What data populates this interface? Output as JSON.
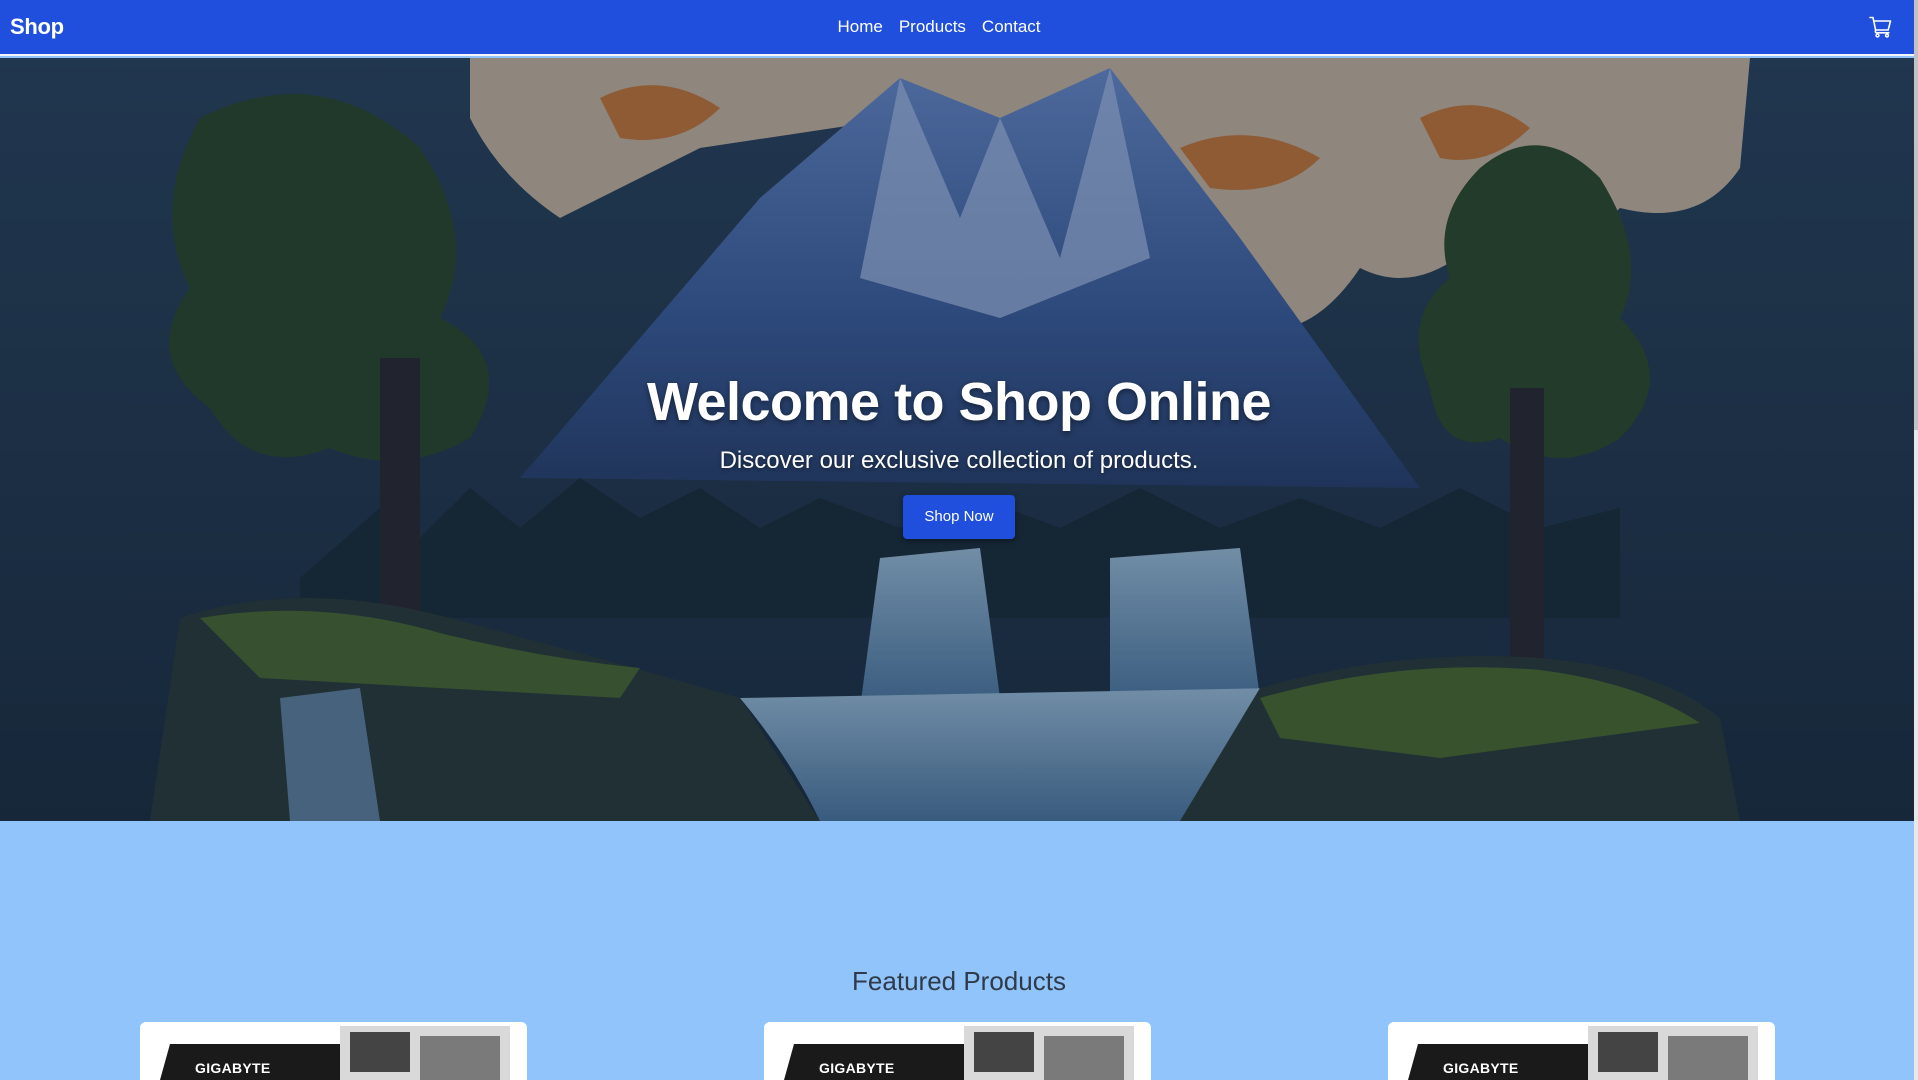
{
  "navbar": {
    "brand": "Shop",
    "links": [
      "Home",
      "Products",
      "Contact"
    ],
    "cart_icon": "cart-icon"
  },
  "hero": {
    "title": "Welcome to Shop Online",
    "subtitle": "Discover our exclusive collection of products.",
    "button_label": "Shop Now"
  },
  "featured": {
    "title": "Featured Products",
    "products": [
      {
        "brand_text": "GIGABYTE"
      },
      {
        "brand_text": "GIGABYTE"
      },
      {
        "brand_text": "GIGABYTE"
      }
    ]
  },
  "colors": {
    "nav_bg": "#1f4fdc",
    "accent": "#1f4fdc",
    "section_bg": "#90c4fa"
  }
}
